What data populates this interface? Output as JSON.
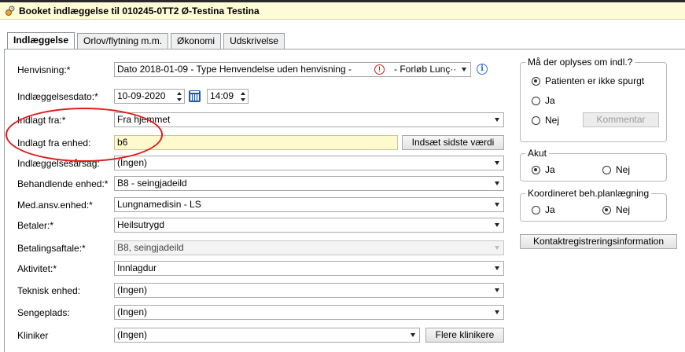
{
  "window": {
    "title": "Booket indlæggelse til 010245-0TT2 Ø-Testina Testina"
  },
  "tabs": [
    {
      "label": "Indlæggelse",
      "active": true
    },
    {
      "label": "Orlov/flytning m.m.",
      "active": false
    },
    {
      "label": "Økonomi",
      "active": false
    },
    {
      "label": "Udskrivelse",
      "active": false
    }
  ],
  "form": {
    "henvisning": {
      "label": "Henvisning:*",
      "value": "Dato 2018-01-09 - Type Henvendelse uden henvisning -",
      "value_after_icon": "- Forløb Lunç··"
    },
    "indlaeggelsesdato": {
      "label": "Indlæggelsesdato:*",
      "date": "10-09-2020",
      "time": "14:09"
    },
    "indlagt_fra": {
      "label": "Indlagt fra:*",
      "value": "Fra hjemmet"
    },
    "indlagt_fra_enhed": {
      "label": "Indlagt fra enhed:",
      "value": "b6",
      "button": "Indsæt sidste værdi"
    },
    "indlaeggelsesarsag": {
      "label": "Indlæggelsesårsag:",
      "value": "(Ingen)"
    },
    "behandlende_enhed": {
      "label": "Behandlende enhed:*",
      "value": "B8 - seingjadeild"
    },
    "med_ansv_enhed": {
      "label": "Med.ansv.enhed:*",
      "value": "Lungnamedisin - LS"
    },
    "betaler": {
      "label": "Betaler:*",
      "value": "Heilsutrygd"
    },
    "betalingsaftale": {
      "label": "Betalingsaftale:*",
      "value": "B8, seingjadeild"
    },
    "aktivitet": {
      "label": "Aktivitet:*",
      "value": "Innlagdur"
    },
    "teknisk_enhed": {
      "label": "Teknisk enhed:",
      "value": "(Ingen)"
    },
    "sengeplads": {
      "label": "Sengeplads:",
      "value": "(Ingen)"
    },
    "kliniker": {
      "label": "Kliniker",
      "value": "(Ingen)",
      "button": "Flere klinikere"
    }
  },
  "right": {
    "oplyses": {
      "legend": "Må der oplyses om indl.?",
      "options": [
        "Patienten er ikke spurgt",
        "Ja",
        "Nej"
      ],
      "selected": "Patienten er ikke spurgt",
      "comment_button": "Kommentar"
    },
    "akut": {
      "legend": "Akut",
      "options": [
        "Ja",
        "Nej"
      ],
      "selected": "Ja"
    },
    "koordineret": {
      "legend": "Koordineret beh.planlægning",
      "options": [
        "Ja",
        "Nej"
      ],
      "selected": "Nej"
    },
    "kontakt_button": "Kontaktregistreringsinformation"
  },
  "colors": {
    "title_bg": "#fefcd6",
    "highlight_field": "#fffacd",
    "annotation": "#e21a1a",
    "info_blue": "#2f6fd1"
  }
}
